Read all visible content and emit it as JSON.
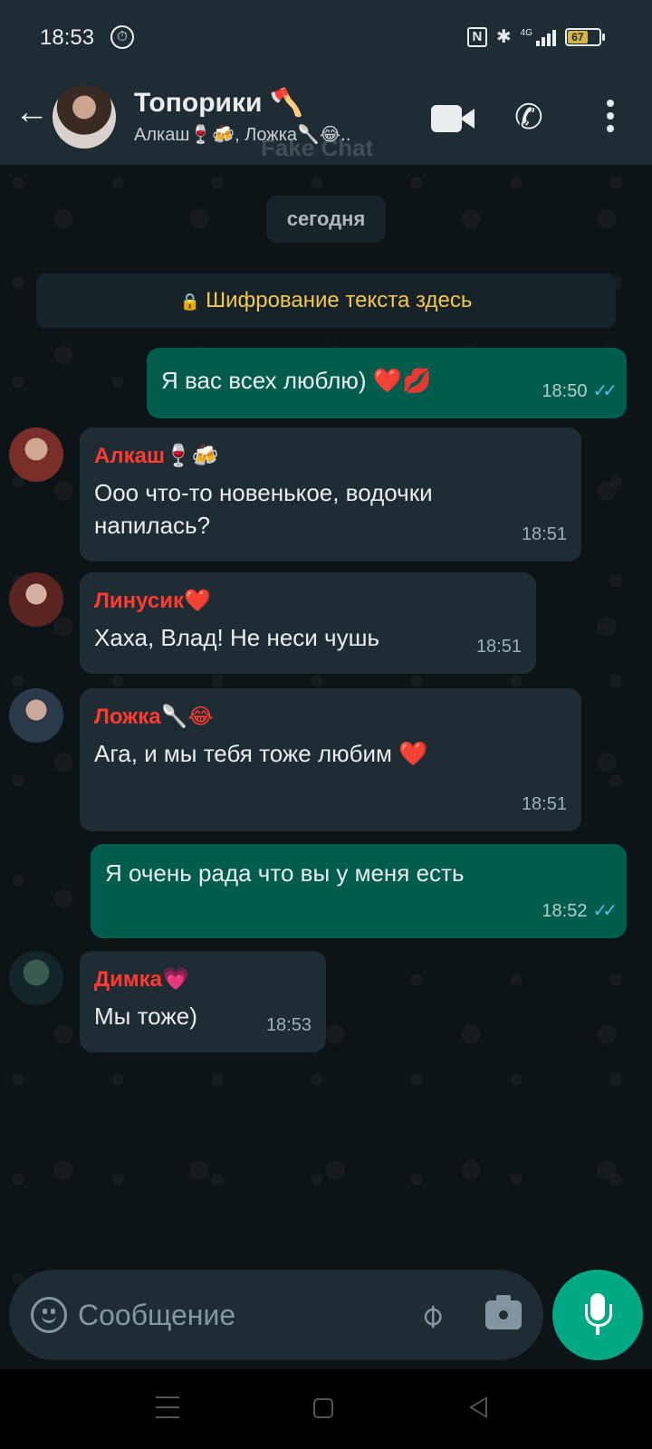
{
  "status_bar": {
    "time": "18:53",
    "network": "4G",
    "battery": "67"
  },
  "header": {
    "back_icon": "arrow-left-icon",
    "title": "Топорики 🪓",
    "subtitle": "Алкаш🍷🍻, Ложка🥄😂..",
    "watermark": "Fake Chat"
  },
  "chat": {
    "date_chip": "сегодня",
    "encryption_note": "Шифрование текста здесь",
    "messages": [
      {
        "direction": "out",
        "text": "Я вас всех люблю) ❤️💋",
        "time": "18:50",
        "read": true
      },
      {
        "direction": "in",
        "sender": "Алкаш🍷🍻",
        "text": "Ооо что-то новенькое, водочки напилась?",
        "time": "18:51"
      },
      {
        "direction": "in",
        "sender": "Линусик❤️",
        "text": "Хаха, Влад! Не неси чушь",
        "time": "18:51"
      },
      {
        "direction": "in",
        "sender": "Ложка🥄😂",
        "text": "Ага, и мы тебя тоже любим ❤️",
        "time": "18:51"
      },
      {
        "direction": "out",
        "text": "Я очень рада что вы у меня есть",
        "time": "18:52",
        "read": true
      },
      {
        "direction": "in",
        "sender": "Димка💗",
        "text": "Мы тоже)",
        "time": "18:53"
      }
    ]
  },
  "composer": {
    "placeholder": "Сообщение"
  },
  "colors": {
    "accent": "#00a884",
    "outgoing": "#005c4b",
    "incoming": "#1f2c34",
    "sender": "#ff3b30",
    "encryption": "#f0c94c"
  }
}
